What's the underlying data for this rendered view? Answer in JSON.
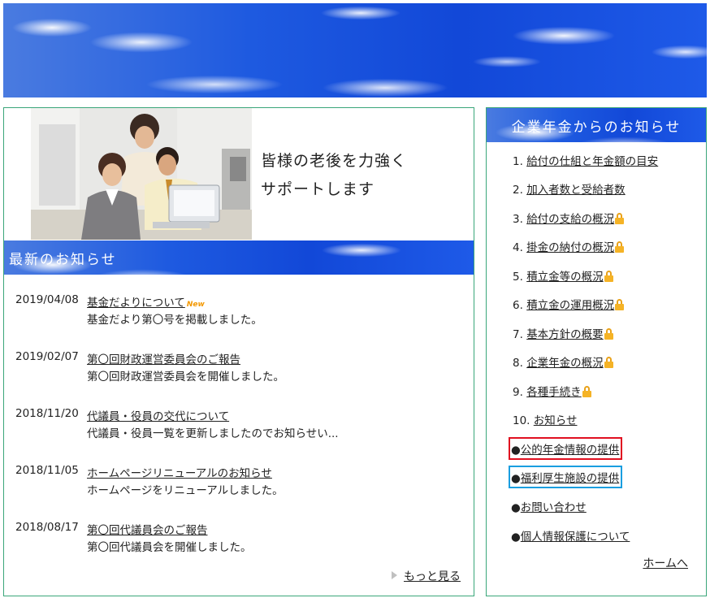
{
  "hero": {
    "line1": "皆様の老後を力強く",
    "line2": "サポートします"
  },
  "news": {
    "header": "最新のお知らせ",
    "items": [
      {
        "date": "2019/04/08",
        "title": "基金だよりについて",
        "badge": "New",
        "body": "基金だより第〇号を掲載しました。"
      },
      {
        "date": "2019/02/07",
        "title": "第〇回財政運営委員会のご報告",
        "badge": "",
        "body": "第〇回財政運営委員会を開催しました。"
      },
      {
        "date": "2018/11/20",
        "title": "代議員・役員の交代について",
        "badge": "",
        "body": "代議員・役員一覧を更新しましたのでお知らせい..."
      },
      {
        "date": "2018/11/05",
        "title": "ホームページリニューアルのお知らせ",
        "badge": "",
        "body": "ホームページをリニューアルしました。"
      },
      {
        "date": "2018/08/17",
        "title": "第〇回代議員会のご報告",
        "badge": "",
        "body": "第〇回代議員会を開催しました。"
      }
    ],
    "more_label": "もっと見る"
  },
  "sidebar": {
    "header": "企業年金からのお知らせ",
    "items": [
      {
        "num": "1.",
        "label": "給付の仕組と年金額の目安",
        "locked": false
      },
      {
        "num": "2.",
        "label": "加入者数と受給者数",
        "locked": false
      },
      {
        "num": "3.",
        "label": "給付の支給の概況",
        "locked": true
      },
      {
        "num": "4.",
        "label": "掛金の納付の概況",
        "locked": true
      },
      {
        "num": "5.",
        "label": "積立金等の概況",
        "locked": true
      },
      {
        "num": "6.",
        "label": "積立金の運用概況",
        "locked": true
      },
      {
        "num": "7.",
        "label": "基本方針の概要",
        "locked": true
      },
      {
        "num": "8.",
        "label": "企業年金の概況",
        "locked": true
      },
      {
        "num": "9.",
        "label": "各種手続き",
        "locked": true
      },
      {
        "num": "10.",
        "label": "お知らせ",
        "locked": false
      }
    ],
    "extra": [
      {
        "bullet": "●",
        "label": "公的年金情報の提供"
      },
      {
        "bullet": "●",
        "label": "福利厚生施設の提供"
      },
      {
        "bullet": "●",
        "label": "お問い合わせ"
      },
      {
        "bullet": "●",
        "label": "個人情報保護について"
      }
    ],
    "home_label": "ホームへ"
  },
  "colors": {
    "border": "#3aa67a",
    "sky": "#1e5ae0",
    "new_badge": "#f39800",
    "lock": "#f5b326",
    "public_box": "#e01020",
    "welfare_box": "#1a9ee0"
  }
}
